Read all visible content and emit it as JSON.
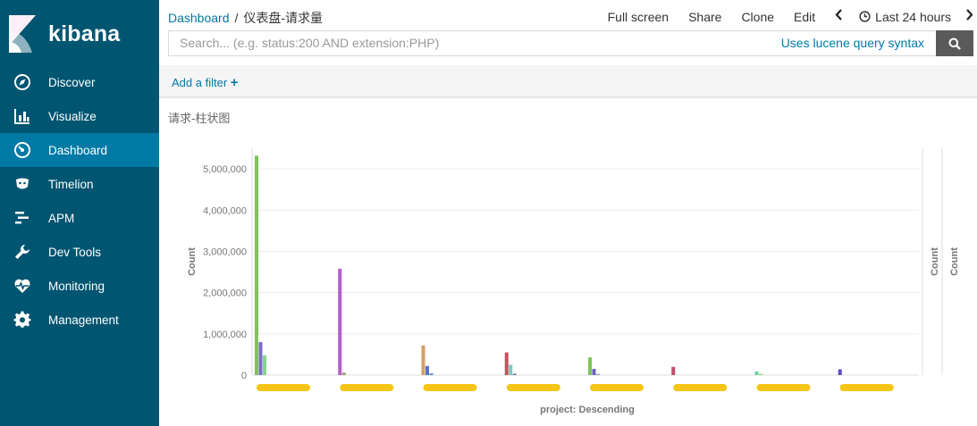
{
  "app": {
    "logo_text": "kibana"
  },
  "sidebar": {
    "items": [
      {
        "label": "Discover",
        "icon": "compass-icon",
        "active": false
      },
      {
        "label": "Visualize",
        "icon": "bar-chart-icon",
        "active": false
      },
      {
        "label": "Dashboard",
        "icon": "dashboard-icon",
        "active": true
      },
      {
        "label": "Timelion",
        "icon": "timelion-icon",
        "active": false
      },
      {
        "label": "APM",
        "icon": "apm-icon",
        "active": false
      },
      {
        "label": "Dev Tools",
        "icon": "wrench-icon",
        "active": false
      },
      {
        "label": "Monitoring",
        "icon": "heartbeat-icon",
        "active": false
      },
      {
        "label": "Management",
        "icon": "gear-icon",
        "active": false
      }
    ]
  },
  "breadcrumb": {
    "parent": "Dashboard",
    "separator": "/",
    "current": "仪表盘-请求量"
  },
  "toolbar": {
    "full_screen": "Full screen",
    "share": "Share",
    "clone": "Clone",
    "edit": "Edit",
    "time_range": "Last 24 hours"
  },
  "search": {
    "placeholder": "Search... (e.g. status:200 AND extension:PHP)",
    "lucene_link": "Uses lucene query syntax"
  },
  "filter": {
    "add_filter": "Add a filter"
  },
  "panel": {
    "title": "请求-柱状图"
  },
  "chart_data": {
    "type": "bar",
    "title": "请求-柱状图",
    "xlabel": "project: Descending",
    "ylabel": "Count",
    "right_axis_labels": [
      "Count",
      "Count"
    ],
    "ylim": [
      0,
      5500000
    ],
    "yticks": [
      0,
      1000000,
      2000000,
      3000000,
      4000000,
      5000000
    ],
    "ytick_labels": [
      "0",
      "1,000,000",
      "2,000,000",
      "3,000,000",
      "4,000,000",
      "5,000,000"
    ],
    "grid": true,
    "bar_groups": [
      {
        "bars": [
          {
            "value": 5320000,
            "color": "#7ec45c"
          },
          {
            "value": 800000,
            "color": "#7b6bc8"
          },
          {
            "value": 480000,
            "color": "#86d68a"
          }
        ]
      },
      {
        "bars": [
          {
            "value": 2580000,
            "color": "#b45ec9"
          },
          {
            "value": 60000,
            "color": "#9aa07a"
          }
        ]
      },
      {
        "bars": [
          {
            "value": 720000,
            "color": "#d59e62"
          },
          {
            "value": 220000,
            "color": "#5a73c8"
          },
          {
            "value": 40000,
            "color": "#5b8fd6"
          }
        ]
      },
      {
        "bars": [
          {
            "value": 550000,
            "color": "#c8505a"
          },
          {
            "value": 250000,
            "color": "#6dcfb8"
          },
          {
            "value": 30000,
            "color": "#5b6fa8"
          }
        ]
      },
      {
        "bars": [
          {
            "value": 430000,
            "color": "#7ec45c"
          },
          {
            "value": 150000,
            "color": "#6a62b8"
          },
          {
            "value": 30000,
            "color": "#9a9ad0"
          }
        ]
      },
      {
        "bars": [
          {
            "value": 200000,
            "color": "#c0506a"
          }
        ]
      },
      {
        "bars": [
          {
            "value": 90000,
            "color": "#6dd6a0"
          },
          {
            "value": 30000,
            "color": "#8ad68a"
          }
        ]
      },
      {
        "bars": [
          {
            "value": 140000,
            "color": "#5a4fc0"
          }
        ]
      }
    ]
  },
  "colors": {
    "sidebar_bg": "#005571",
    "sidebar_active": "#0079a5",
    "link": "#0079a5",
    "redaction": "#f5c518"
  }
}
